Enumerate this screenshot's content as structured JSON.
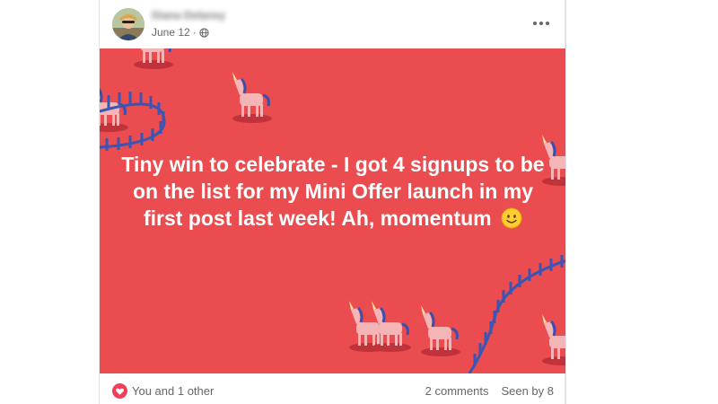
{
  "post": {
    "author": "Diana Delaney",
    "date": "June 12",
    "date_separator": "·",
    "visibility_icon": "globe-icon",
    "more_icon": "more-options-icon",
    "text": "Tiny win to celebrate - I got 4 signups to be on the list for my Mini Offer launch in my first post last week! Ah, momentum",
    "emoji": "slightly-smiling-face",
    "background_color": "#ea4c4f",
    "footer": {
      "reaction_icon": "heart-icon",
      "reactions_text": "You and 1 other",
      "comments": "2 comments",
      "seen_by": "Seen by 8"
    }
  }
}
